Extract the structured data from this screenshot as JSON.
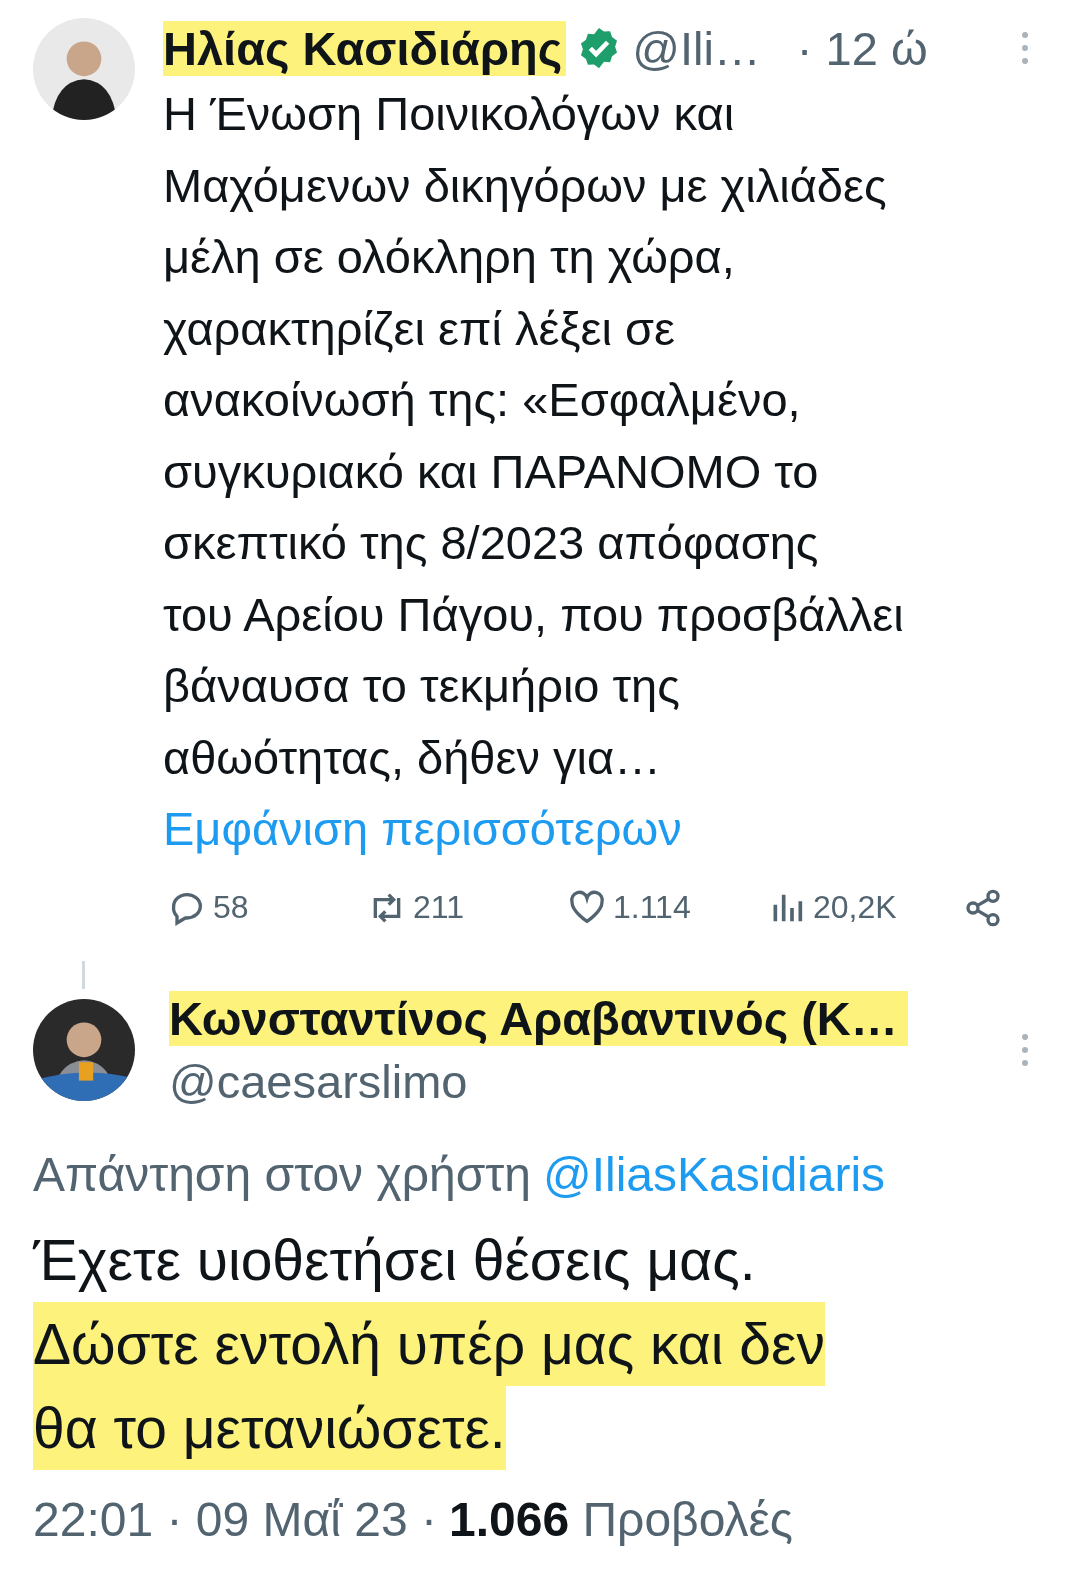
{
  "tweet": {
    "author": {
      "name": "Ηλίας Κασιδιάρης",
      "highlighted": true,
      "verified": true,
      "handle": "@Ili…",
      "time": "· 12 ώ"
    },
    "body_lines": [
      "Η Ένωση Ποινικολόγων και",
      "Μαχόμενων δικηγόρων με χιλιάδες",
      "μέλη σε ολόκληρη τη χώρα,",
      "χαρακτηρίζει επί λέξει σε",
      "ανακοίνωσή της: «Εσφαλμένο,",
      "συγκυριακό και ΠΑΡΑΝΟΜΟ το",
      "σκεπτικό της 8/2023 απόφασης",
      "του Αρείου Πάγου, που προσβάλλει",
      "βάναυσα το τεκμήριο της",
      "αθωότητας, δήθεν για…"
    ],
    "show_more": "Εμφάνιση περισσότερων",
    "actions": [
      {
        "kind": "reply",
        "count": "58"
      },
      {
        "kind": "retweet",
        "count": "211"
      },
      {
        "kind": "like",
        "count": "1.114"
      },
      {
        "kind": "views",
        "count": "20,2K"
      },
      {
        "kind": "share"
      }
    ]
  },
  "reply": {
    "author": {
      "name": "Κωνσταντίνος Αραβαντινός (Κ…",
      "highlighted": true,
      "handle": "@caesarslimo"
    },
    "replying_to": {
      "text": "Απάντηση στον χρήστη",
      "user": "@IliasKasidiaris"
    },
    "body": [
      {
        "text": "Έχετε υιοθετήσει θέσεις μας.",
        "highlighted": false
      },
      {
        "text": "Δώστε εντολή υπέρ μας και δεν",
        "highlighted": true
      },
      {
        "text": "θα το μετανιώσετε.",
        "highlighted": true
      }
    ],
    "footer": {
      "time": "22:01 · 09 Μαΐ 23 ·",
      "views": "1.066",
      "views_label": "Προβολές"
    }
  }
}
